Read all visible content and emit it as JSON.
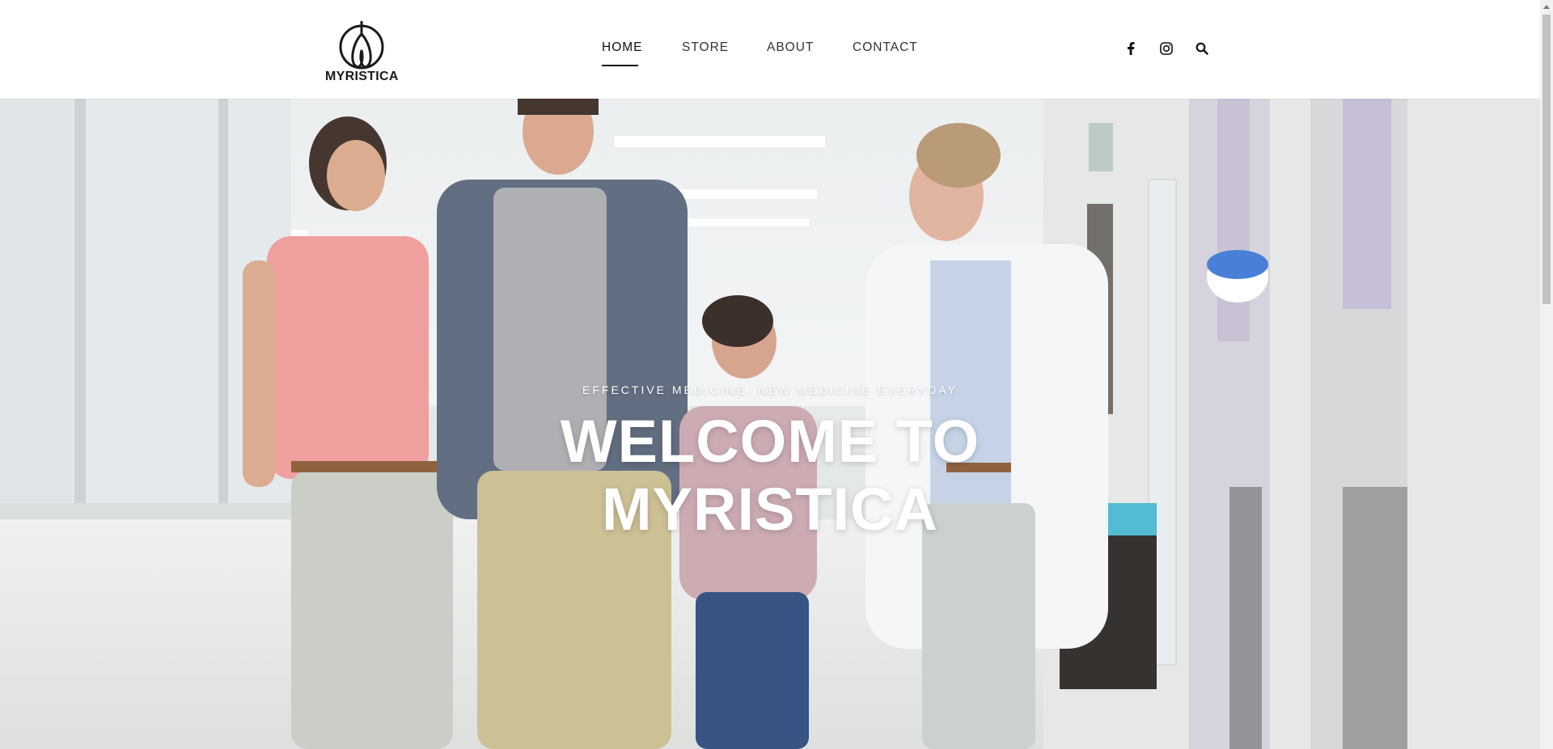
{
  "brand": {
    "logo_icon": "myristica-logo-icon",
    "name": "MYRISTICA"
  },
  "nav": {
    "items": [
      {
        "label": "HOME",
        "active": true
      },
      {
        "label": "STORE",
        "active": false
      },
      {
        "label": "ABOUT",
        "active": false
      },
      {
        "label": "CONTACT",
        "active": false
      }
    ]
  },
  "header_icons": [
    {
      "name": "facebook-icon"
    },
    {
      "name": "instagram-icon"
    },
    {
      "name": "search-icon"
    }
  ],
  "hero": {
    "image": "family-with-doctor-hospital-corridor-photo",
    "subtitle": "EFFECTIVE MEDICINE, NEW MEDICINE EVERYDAY",
    "title_line1": "WELCOME TO",
    "title_line2": "MYRISTICA"
  },
  "colors": {
    "header_bg": "#ffffff",
    "text_dark": "#111111",
    "hero_text": "#ffffff"
  }
}
